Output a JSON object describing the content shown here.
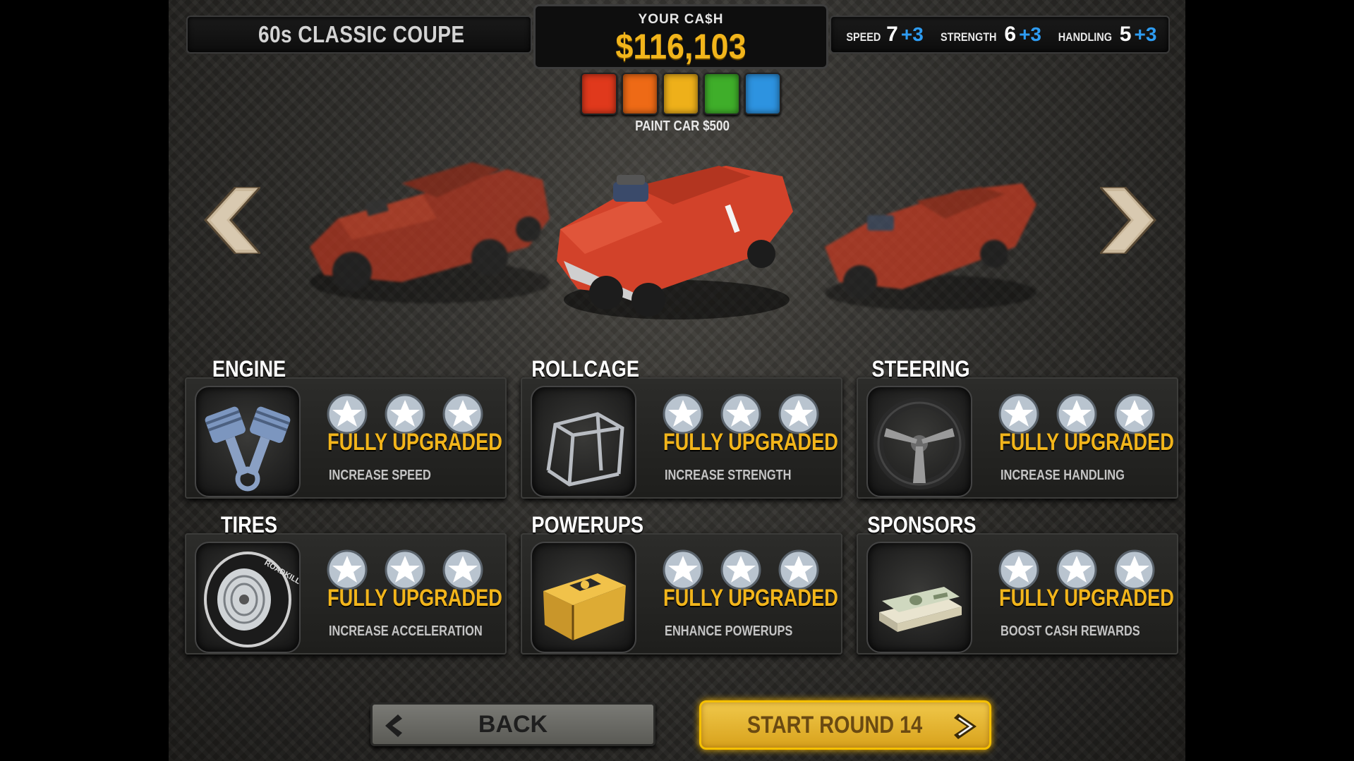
{
  "header": {
    "car_name": "60s CLASSIC COUPE",
    "cash_label": "YOUR CA$H",
    "cash_value": "$116,103"
  },
  "stats": [
    {
      "label": "SPEED",
      "value": "7",
      "bonus": "+3"
    },
    {
      "label": "STRENGTH",
      "value": "6",
      "bonus": "+3"
    },
    {
      "label": "HANDLING",
      "value": "5",
      "bonus": "+3"
    }
  ],
  "paint": {
    "label": "PAINT CAR $500",
    "colors": [
      "#e0391c",
      "#ee6a16",
      "#eeb01a",
      "#3fae2a",
      "#2d93e0"
    ]
  },
  "carousel": {
    "prev_icon": "chevron-left-icon",
    "next_icon": "chevron-right-icon"
  },
  "upgrades": [
    {
      "title": "ENGINE",
      "status": "FULLY UPGRADED",
      "desc": "INCREASE SPEED",
      "stars": 3,
      "icon": "pistons-icon"
    },
    {
      "title": "ROLLCAGE",
      "status": "FULLY UPGRADED",
      "desc": "INCREASE STRENGTH",
      "stars": 3,
      "icon": "rollcage-icon"
    },
    {
      "title": "STEERING",
      "status": "FULLY UPGRADED",
      "desc": "INCREASE HANDLING",
      "stars": 3,
      "icon": "steering-wheel-icon"
    },
    {
      "title": "TIRES",
      "status": "FULLY UPGRADED",
      "desc": "INCREASE ACCELERATION",
      "stars": 3,
      "icon": "tire-icon"
    },
    {
      "title": "POWERUPS",
      "status": "FULLY UPGRADED",
      "desc": "ENHANCE POWERUPS",
      "stars": 3,
      "icon": "crate-icon"
    },
    {
      "title": "SPONSORS",
      "status": "FULLY UPGRADED",
      "desc": "BOOST CASH REWARDS",
      "stars": 3,
      "icon": "cash-stack-icon"
    }
  ],
  "tire_brand": "ROADKILL",
  "buttons": {
    "back": "BACK",
    "start": "START ROUND 14"
  }
}
